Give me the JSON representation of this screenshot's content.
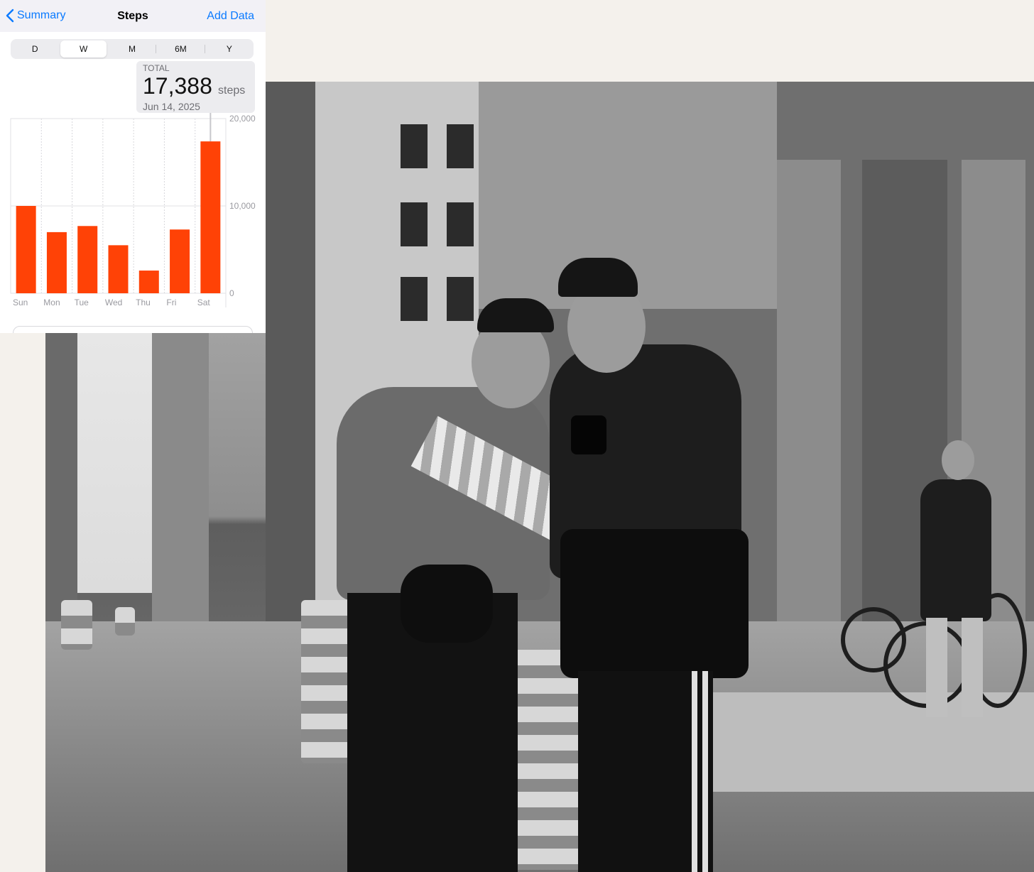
{
  "nav": {
    "back_label": "Summary",
    "title": "Steps",
    "add_label": "Add Data"
  },
  "ranges": [
    "D",
    "W",
    "M",
    "6M",
    "Y"
  ],
  "selected_range": "W",
  "callout": {
    "label": "TOTAL",
    "value": "17,388",
    "unit": "steps",
    "date": "Jun 14, 2025"
  },
  "colors": {
    "accent": "#0a7aff",
    "bar": "#ff4206"
  },
  "chart_data": {
    "type": "bar",
    "categories": [
      "Sun",
      "Mon",
      "Tue",
      "Wed",
      "Thu",
      "Fri",
      "Sat"
    ],
    "values": [
      10000,
      7000,
      7700,
      5500,
      2600,
      7300,
      17388
    ],
    "ylim": [
      0,
      20000
    ],
    "y_ticks": [
      0,
      10000,
      20000
    ],
    "y_tick_labels": [
      "0",
      "10,000",
      "20,000"
    ],
    "selected_index": 6,
    "grid": true
  }
}
